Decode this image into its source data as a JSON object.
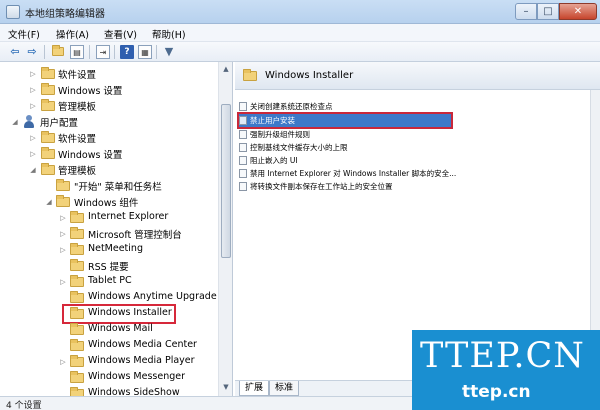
{
  "window": {
    "title": "本地组策略编辑器",
    "min_label": "–",
    "max_label": "□",
    "close_label": "✕"
  },
  "menu": [
    "文件(F)",
    "操作(A)",
    "查看(V)",
    "帮助(H)"
  ],
  "toolbar": {
    "icons": [
      "back-icon",
      "forward-icon",
      "up-folder-icon",
      "show-tree-icon",
      "export-icon",
      "help-icon",
      "properties-icon",
      "filter-icon"
    ]
  },
  "tree": [
    {
      "label": "软件设置",
      "expander": "▷",
      "icon": "folder"
    },
    {
      "label": "Windows 设置",
      "expander": "▷",
      "icon": "folder"
    },
    {
      "label": "管理模板",
      "expander": "▷",
      "icon": "folder"
    },
    {
      "label": "用户配置",
      "expander": "◢",
      "icon": "user"
    },
    {
      "label": "软件设置",
      "expander": "▷",
      "icon": "folder"
    },
    {
      "label": "Windows 设置",
      "expander": "▷",
      "icon": "folder"
    },
    {
      "label": "管理模板",
      "expander": "◢",
      "icon": "folder"
    },
    {
      "label": "\"开始\" 菜单和任务栏",
      "expander": "",
      "icon": "folder"
    },
    {
      "label": "Windows 组件",
      "expander": "◢",
      "icon": "folder"
    },
    {
      "label": "Internet Explorer",
      "expander": "▷",
      "icon": "folder"
    },
    {
      "label": "Microsoft 管理控制台",
      "expander": "▷",
      "icon": "folder"
    },
    {
      "label": "NetMeeting",
      "expander": "▷",
      "icon": "folder"
    },
    {
      "label": "RSS 提要",
      "expander": "",
      "icon": "folder"
    },
    {
      "label": "Tablet PC",
      "expander": "▷",
      "icon": "folder"
    },
    {
      "label": "Windows Anytime Upgrade",
      "expander": "",
      "icon": "folder"
    },
    {
      "label": "Windows Installer",
      "expander": "",
      "icon": "folder",
      "selected": true
    },
    {
      "label": "Windows Mail",
      "expander": "",
      "icon": "folder"
    },
    {
      "label": "Windows Media Center",
      "expander": "",
      "icon": "folder"
    },
    {
      "label": "Windows Media Player",
      "expander": "▷",
      "icon": "folder"
    },
    {
      "label": "Windows Messenger",
      "expander": "",
      "icon": "folder"
    },
    {
      "label": "Windows SideShow",
      "expander": "",
      "icon": "folder"
    }
  ],
  "right": {
    "title": "Windows Installer",
    "policies": [
      {
        "label": "关闭创建系统还原检查点"
      },
      {
        "label": "禁止用户安装",
        "selected": true
      },
      {
        "label": "强制升级组件规则"
      },
      {
        "label": "控制基线文件缓存大小的上限"
      },
      {
        "label": "阻止嵌入的 UI"
      },
      {
        "label": "禁用 Internet Explorer 对 Windows Installer 脚本的安全..."
      },
      {
        "label": "将转换文件副本保存在工作站上的安全位置"
      }
    ]
  },
  "tabs": [
    "扩展",
    "标准"
  ],
  "status": "4 个设置",
  "watermark": {
    "big": "TTEP.CN",
    "small": "ttep.cn"
  },
  "colors": {
    "selection": "#3d79c9",
    "highlight_border": "#d6283a",
    "watermark": "#1a8fd1"
  }
}
